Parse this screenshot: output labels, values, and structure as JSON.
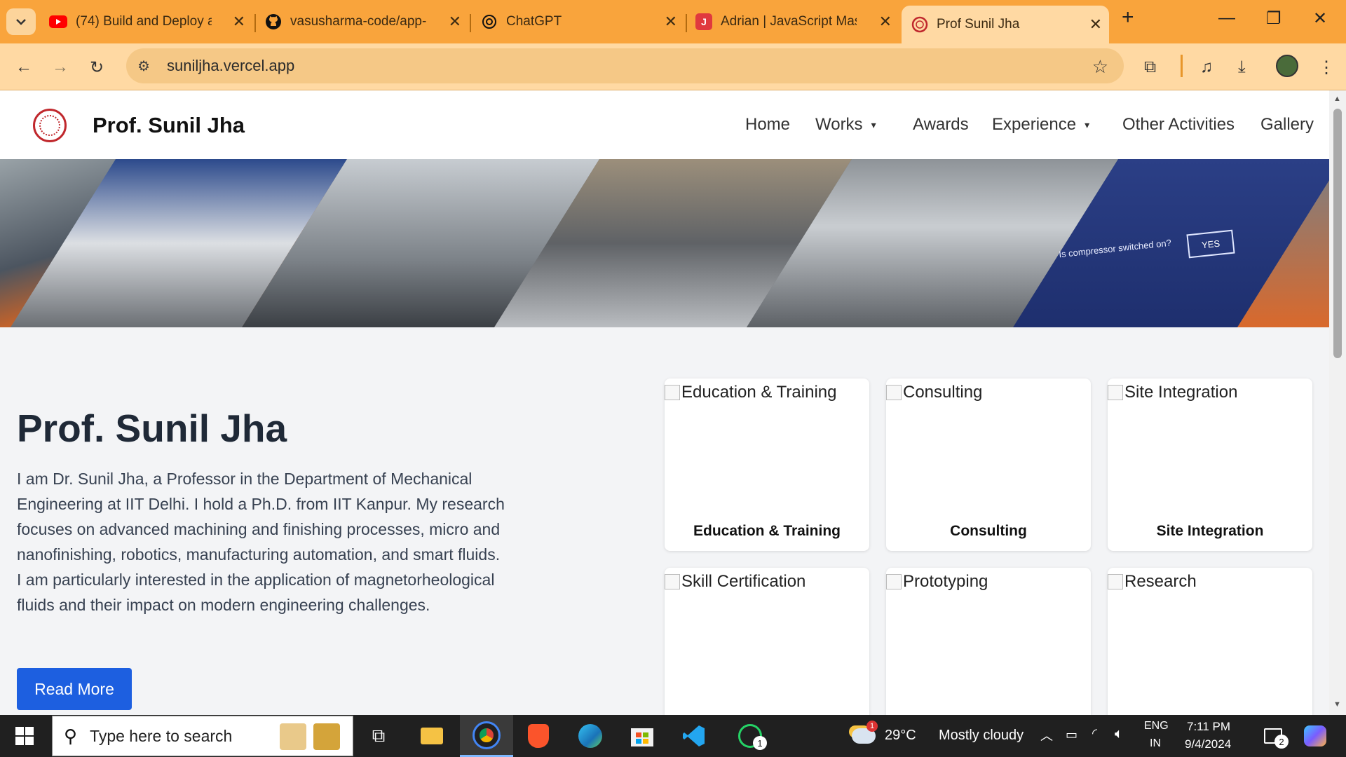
{
  "browser": {
    "tabs": [
      {
        "title": "(74) Build and Deploy an",
        "icon": "youtube-icon",
        "color": "#ff0000"
      },
      {
        "title": "vasusharma-code/app-ca",
        "icon": "github-icon",
        "color": "#111111"
      },
      {
        "title": "ChatGPT",
        "icon": "chatgpt-icon",
        "color": "#111111"
      },
      {
        "title": "Adrian | JavaScript Maste",
        "icon": "jsmastery-icon",
        "color": "#e0393e"
      },
      {
        "title": "Prof Sunil Jha",
        "icon": "iitd-logo-icon",
        "color": "#c0282d"
      }
    ],
    "active_tab": 4,
    "url": "suniljha.vercel.app"
  },
  "site": {
    "brand": "Prof. Sunil Jha",
    "nav": [
      {
        "label": "Home",
        "dropdown": false
      },
      {
        "label": "Works",
        "dropdown": true
      },
      {
        "label": "Awards",
        "dropdown": false
      },
      {
        "label": "Experience",
        "dropdown": true
      },
      {
        "label": "Other Activities",
        "dropdown": false
      },
      {
        "label": "Gallery",
        "dropdown": false
      }
    ],
    "hero": {
      "overlay_text": "Is compressor switched on?",
      "overlay_button": "YES"
    },
    "about": {
      "title": "Prof. Sunil Jha",
      "text": "I am Dr. Sunil Jha, a Professor in the Department of Mechanical Engineering at IIT Delhi. I hold a Ph.D. from IIT Kanpur. My research focuses on advanced machining and finishing processes, micro and nanofinishing, robotics, manufacturing automation, and smart fluids. I am particularly interested in the application of magnetorheological fluids and their impact on modern engineering challenges.",
      "button": "Read More"
    },
    "cards": [
      {
        "alt": "Education & Training",
        "caption": "Education & Training"
      },
      {
        "alt": "Consulting",
        "caption": "Consulting"
      },
      {
        "alt": "Site Integration",
        "caption": "Site Integration"
      },
      {
        "alt": "Skill Certification",
        "caption": ""
      },
      {
        "alt": "Prototyping",
        "caption": ""
      },
      {
        "alt": "Research",
        "caption": ""
      }
    ]
  },
  "taskbar": {
    "search_placeholder": "Type here to search",
    "weather": {
      "temp": "29°C",
      "desc": "Mostly cloudy",
      "badge": "1"
    },
    "lang": {
      "line1": "ENG",
      "line2": "IN"
    },
    "time": "7:11 PM",
    "date": "9/4/2024",
    "notifications": "2",
    "whatsapp_badge": "1"
  },
  "colors": {
    "accent": "#1d5fe0",
    "chrome": "#f9a43c",
    "toolbar": "#ffd9a3"
  }
}
